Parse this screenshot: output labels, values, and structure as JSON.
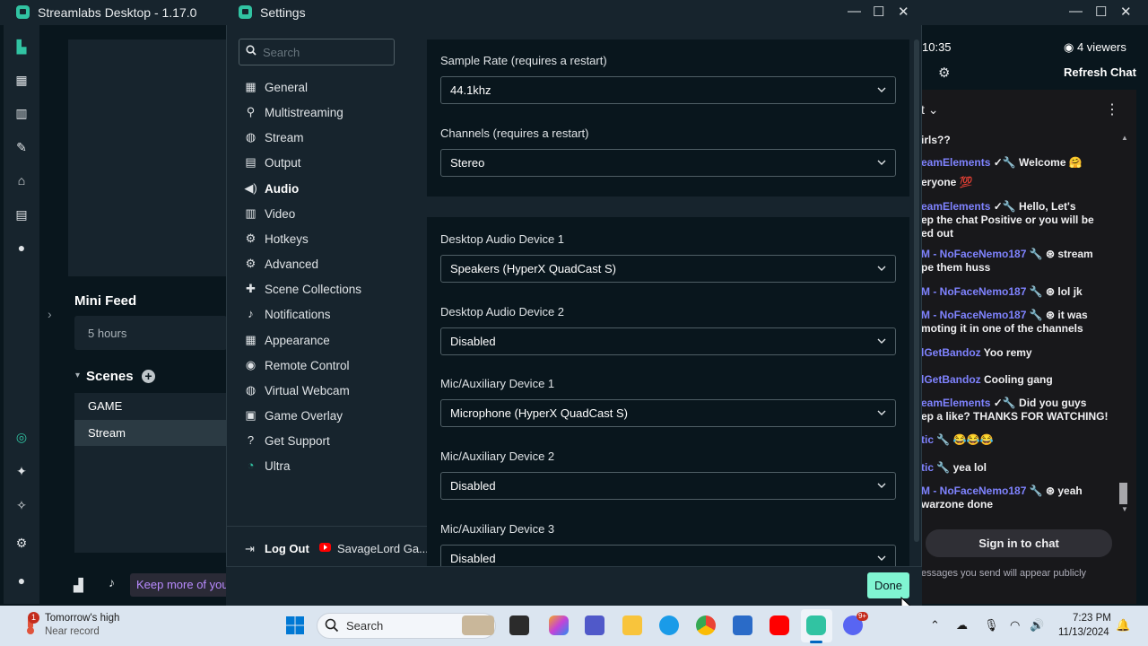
{
  "app": {
    "title": "Streamlabs Desktop - 1.17.0"
  },
  "editor": {
    "mini_feed_title": "Mini Feed",
    "mini_feed_item": "5 hours",
    "scenes_title": "Scenes",
    "scenes": [
      "GAME",
      "Stream"
    ],
    "promo": "Keep more of you"
  },
  "chat": {
    "time": "10:35",
    "viewers": "4 viewers",
    "refresh": "Refresh Chat",
    "header_fragment": "t",
    "lines": [
      {
        "name": "",
        "text": "irls??"
      },
      {
        "name": "eamElements",
        "text": " ✓🔧  Welcome 🤗"
      },
      {
        "name": "",
        "text": "eryone 💯"
      },
      {
        "name": "eamElements",
        "text": " ✓🔧  Hello, Let's"
      },
      {
        "name": "",
        "text": "ep the chat Positive or you will be"
      },
      {
        "name": "",
        "text": "ed out"
      },
      {
        "name": "M - NoFaceNemo187",
        "text": " 🔧 ⊛  stream"
      },
      {
        "name": "",
        "text": "pe them huss"
      },
      {
        "name": "M - NoFaceNemo187",
        "text": " 🔧 ⊛  lol jk"
      },
      {
        "name": "M - NoFaceNemo187",
        "text": " 🔧 ⊛  it was"
      },
      {
        "name": "",
        "text": "moting it in one of the channels"
      },
      {
        "name": "lGetBandoz",
        "text": "  Yoo remy"
      },
      {
        "name": "lGetBandoz",
        "text": "  Cooling gang"
      },
      {
        "name": "eamElements",
        "text": " ✓🔧  Did you guys"
      },
      {
        "name": "",
        "text": "ep a like? THANKS FOR WATCHING!"
      },
      {
        "name": "tic",
        "text": " 🔧  😂😂😂"
      },
      {
        "name": "tic",
        "text": " 🔧  yea lol"
      },
      {
        "name": "M - NoFaceNemo187",
        "text": " 🔧 ⊛  yeah"
      },
      {
        "name": "",
        "text": "warzone done"
      }
    ],
    "sign_in": "Sign in to chat",
    "note": "essages you send will appear publicly"
  },
  "settings": {
    "title": "Settings",
    "search_placeholder": "Search",
    "nav": [
      {
        "label": "General",
        "icon": "general-icon",
        "glyph": "▦"
      },
      {
        "label": "Multistreaming",
        "icon": "multistream-icon",
        "glyph": "⚲"
      },
      {
        "label": "Stream",
        "icon": "globe-icon",
        "glyph": "◍"
      },
      {
        "label": "Output",
        "icon": "output-icon",
        "glyph": "▤"
      },
      {
        "label": "Audio",
        "icon": "speaker-icon",
        "glyph": "◀)"
      },
      {
        "label": "Video",
        "icon": "film-icon",
        "glyph": "▥"
      },
      {
        "label": "Hotkeys",
        "icon": "gear-icon",
        "glyph": "⚙"
      },
      {
        "label": "Advanced",
        "icon": "cogs-icon",
        "glyph": "⚙"
      },
      {
        "label": "Scene Collections",
        "icon": "puzzle-icon",
        "glyph": "✚"
      },
      {
        "label": "Notifications",
        "icon": "bell-icon",
        "glyph": "♪"
      },
      {
        "label": "Appearance",
        "icon": "appearance-icon",
        "glyph": "▦"
      },
      {
        "label": "Remote Control",
        "icon": "remote-icon",
        "glyph": "◉"
      },
      {
        "label": "Virtual Webcam",
        "icon": "webcam-icon",
        "glyph": "◍"
      },
      {
        "label": "Game Overlay",
        "icon": "overlay-icon",
        "glyph": "▣"
      },
      {
        "label": "Get Support",
        "icon": "help-icon",
        "glyph": "?"
      },
      {
        "label": "Ultra",
        "icon": "ultra-icon",
        "glyph": "◔"
      }
    ],
    "active_nav": "Audio",
    "log_out": "Log Out",
    "channel": "SavageLord Ga...",
    "fields": [
      {
        "label": "Sample Rate (requires a restart)",
        "value": "44.1khz"
      },
      {
        "label": "Channels (requires a restart)",
        "value": "Stereo"
      },
      {
        "label": "Desktop Audio Device 1",
        "value": "Speakers (HyperX QuadCast S)"
      },
      {
        "label": "Desktop Audio Device 2",
        "value": "Disabled"
      },
      {
        "label": "Mic/Auxiliary Device 1",
        "value": "Microphone (HyperX QuadCast S)"
      },
      {
        "label": "Mic/Auxiliary Device 2",
        "value": "Disabled"
      },
      {
        "label": "Mic/Auxiliary Device 3",
        "value": "Disabled"
      }
    ],
    "done": "Done"
  },
  "taskbar": {
    "weather_title": "Tomorrow's high",
    "weather_sub": "Near record",
    "weather_badge": "1",
    "search": "Search",
    "discord_badge": "9+",
    "time": "7:23 PM",
    "date": "11/13/2024"
  },
  "colors": {
    "accent": "#80f5d2",
    "brand": "#31c3a2",
    "bg": "#09161d",
    "panel": "#17242d"
  }
}
